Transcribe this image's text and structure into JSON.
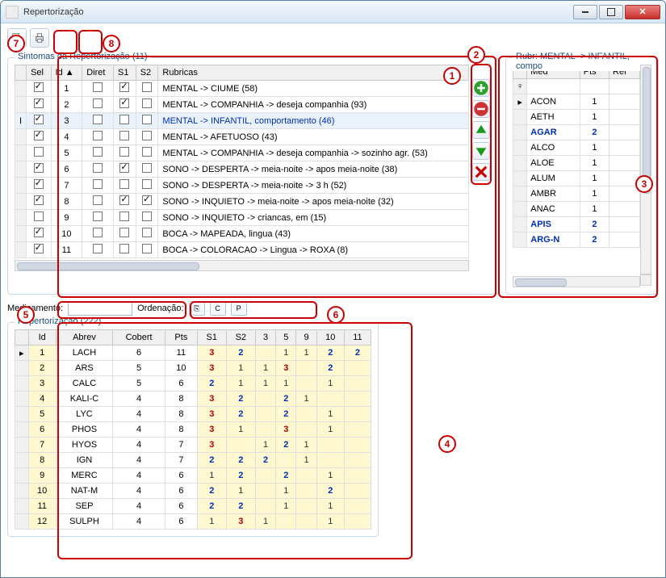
{
  "window": {
    "title": "Repertorização"
  },
  "symptoms": {
    "legend": "Sintomas da Repertorização (11)",
    "cols": {
      "sel": "Sel",
      "id": "Id ▲",
      "diret": "Diret",
      "s1": "S1",
      "s2": "S2",
      "rubricas": "Rubricas"
    },
    "rows": [
      {
        "mark": "",
        "sel": true,
        "id": "1",
        "diret": false,
        "s1": true,
        "s2": false,
        "rubr": "MENTAL -> CIUME (58)"
      },
      {
        "mark": "",
        "sel": true,
        "id": "2",
        "diret": false,
        "s1": true,
        "s2": false,
        "rubr": "MENTAL -> COMPANHIA -> deseja companhia (93)"
      },
      {
        "mark": "I",
        "sel": true,
        "id": "3",
        "diret": false,
        "s1": false,
        "s2": false,
        "rubr": "MENTAL -> INFANTIL, comportamento (46)",
        "selrow": true,
        "link": true
      },
      {
        "mark": "",
        "sel": true,
        "id": "4",
        "diret": false,
        "s1": false,
        "s2": false,
        "rubr": "MENTAL -> AFETUOSO (43)"
      },
      {
        "mark": "",
        "sel": false,
        "id": "5",
        "diret": false,
        "s1": false,
        "s2": false,
        "rubr": "MENTAL -> COMPANHIA -> deseja companhia -> sozinho agr. (53)"
      },
      {
        "mark": "",
        "sel": true,
        "id": "6",
        "diret": false,
        "s1": true,
        "s2": false,
        "rubr": "SONO -> DESPERTA -> meia-noite -> apos meia-noite (38)"
      },
      {
        "mark": "",
        "sel": true,
        "id": "7",
        "diret": false,
        "s1": false,
        "s2": false,
        "rubr": "SONO -> DESPERTA -> meia-noite -> 3 h (52)"
      },
      {
        "mark": "",
        "sel": true,
        "id": "8",
        "diret": false,
        "s1": true,
        "s2": true,
        "rubr": "SONO -> INQUIETO -> meia-noite -> apos meia-noite (32)"
      },
      {
        "mark": "",
        "sel": false,
        "id": "9",
        "diret": false,
        "s1": false,
        "s2": false,
        "rubr": "SONO -> INQUIETO -> criancas, em (15)"
      },
      {
        "mark": "",
        "sel": true,
        "id": "10",
        "diret": false,
        "s1": false,
        "s2": false,
        "rubr": "BOCA -> MAPEADA, lingua (43)"
      },
      {
        "mark": "",
        "sel": true,
        "id": "11",
        "diret": false,
        "s1": false,
        "s2": false,
        "rubr": "BOCA -> COLORACAO -> Lingua -> ROXA (8)"
      }
    ]
  },
  "rubr": {
    "legend": "Rubr: MENTAL -> INFANTIL, compo",
    "cols": {
      "med": "Med",
      "pts": "Pts",
      "ref": "Ref"
    },
    "filter_indicator": "♀",
    "rows": [
      {
        "mark": "▸",
        "med": "ACON",
        "pts": "1",
        "bold": false
      },
      {
        "mark": "",
        "med": "AETH",
        "pts": "1",
        "bold": false
      },
      {
        "mark": "",
        "med": "AGAR",
        "pts": "2",
        "bold": true
      },
      {
        "mark": "",
        "med": "ALCO",
        "pts": "1",
        "bold": false
      },
      {
        "mark": "",
        "med": "ALOE",
        "pts": "1",
        "bold": false
      },
      {
        "mark": "",
        "med": "ALUM",
        "pts": "1",
        "bold": false
      },
      {
        "mark": "",
        "med": "AMBR",
        "pts": "1",
        "bold": false
      },
      {
        "mark": "",
        "med": "ANAC",
        "pts": "1",
        "bold": false
      },
      {
        "mark": "",
        "med": "APIS",
        "pts": "2",
        "bold": true
      },
      {
        "mark": "",
        "med": "ARG-N",
        "pts": "2",
        "bold": true
      }
    ]
  },
  "filter": {
    "med_label": "Medicamento:",
    "ord_label": "Ordenação:",
    "b1": "⎘",
    "b2": "C",
    "b3": "P"
  },
  "results": {
    "legend": "Repertorização (222)",
    "cols": [
      "",
      "Id",
      "Abrev",
      "Cobert",
      "Pts",
      "S1",
      "S2",
      "3",
      "5",
      "9",
      "10",
      "11"
    ],
    "rows": [
      {
        "mark": "▸",
        "id": "1",
        "ab": "LACH",
        "cob": "6",
        "pts": "11",
        "v": [
          "3",
          "2",
          "",
          "1",
          "1",
          "2",
          "2"
        ]
      },
      {
        "mark": "",
        "id": "2",
        "ab": "ARS",
        "cob": "5",
        "pts": "10",
        "v": [
          "3",
          "1",
          "1",
          "3",
          "",
          "2",
          ""
        ]
      },
      {
        "mark": "",
        "id": "3",
        "ab": "CALC",
        "cob": "5",
        "pts": "6",
        "v": [
          "2",
          "1",
          "1",
          "1",
          "",
          "1",
          ""
        ]
      },
      {
        "mark": "",
        "id": "4",
        "ab": "KALI-C",
        "cob": "4",
        "pts": "8",
        "v": [
          "3",
          "2",
          "",
          "2",
          "1",
          "",
          ""
        ]
      },
      {
        "mark": "",
        "id": "5",
        "ab": "LYC",
        "cob": "4",
        "pts": "8",
        "v": [
          "3",
          "2",
          "",
          "2",
          "",
          "1",
          ""
        ]
      },
      {
        "mark": "",
        "id": "6",
        "ab": "PHOS",
        "cob": "4",
        "pts": "8",
        "v": [
          "3",
          "1",
          "",
          "3",
          "",
          "1",
          ""
        ]
      },
      {
        "mark": "",
        "id": "7",
        "ab": "HYOS",
        "cob": "4",
        "pts": "7",
        "v": [
          "3",
          "",
          "1",
          "2",
          "1",
          "",
          ""
        ]
      },
      {
        "mark": "",
        "id": "8",
        "ab": "IGN",
        "cob": "4",
        "pts": "7",
        "v": [
          "2",
          "2",
          "2",
          "",
          "1",
          "",
          ""
        ]
      },
      {
        "mark": "",
        "id": "9",
        "ab": "MERC",
        "cob": "4",
        "pts": "6",
        "v": [
          "1",
          "2",
          "",
          "2",
          "",
          "1",
          ""
        ]
      },
      {
        "mark": "",
        "id": "10",
        "ab": "NAT-M",
        "cob": "4",
        "pts": "6",
        "v": [
          "2",
          "1",
          "",
          "1",
          "",
          "2",
          ""
        ]
      },
      {
        "mark": "",
        "id": "11",
        "ab": "SEP",
        "cob": "4",
        "pts": "6",
        "v": [
          "2",
          "2",
          "",
          "1",
          "",
          "1",
          ""
        ]
      },
      {
        "mark": "",
        "id": "12",
        "ab": "SULPH",
        "cob": "4",
        "pts": "6",
        "v": [
          "1",
          "3",
          "1",
          "",
          "",
          "1",
          ""
        ]
      }
    ]
  },
  "annotations": {
    "1": "1",
    "2": "2",
    "3": "3",
    "4": "4",
    "5": "5",
    "6": "6",
    "7": "7",
    "8": "8"
  }
}
